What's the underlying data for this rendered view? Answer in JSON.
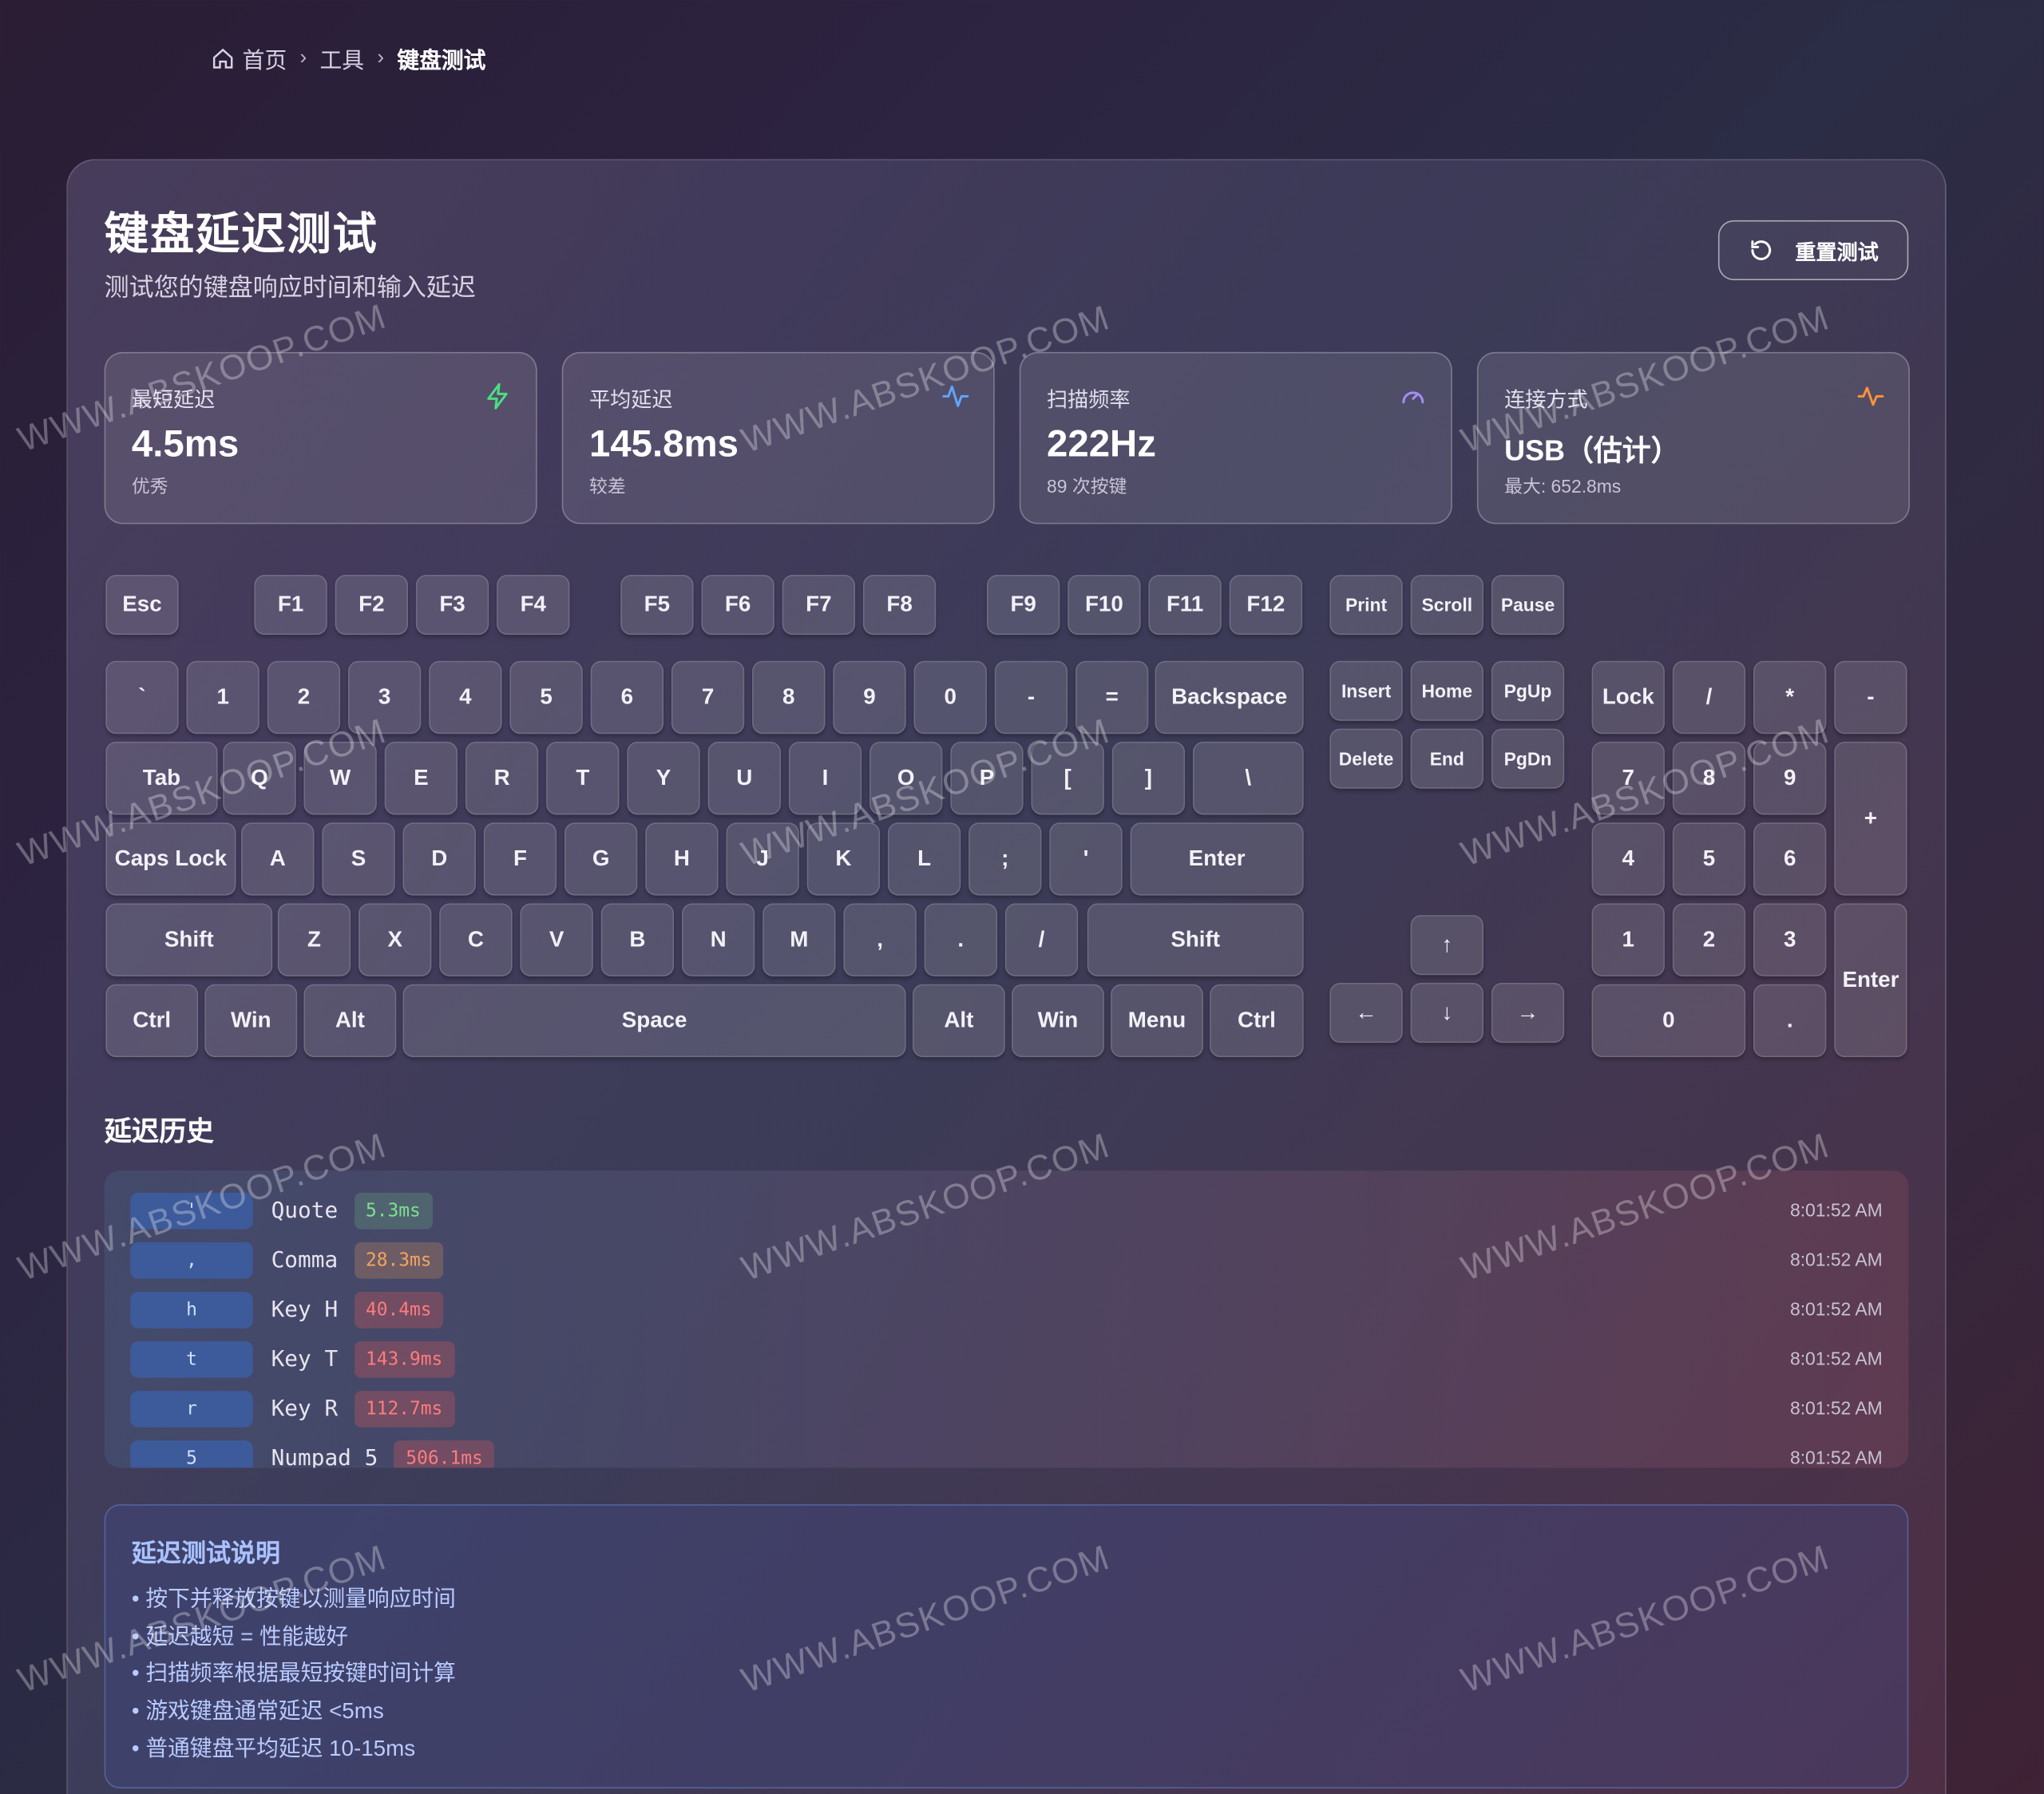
{
  "breadcrumb": {
    "home": "首页",
    "tools": "工具",
    "current": "键盘测试"
  },
  "header": {
    "title": "键盘延迟测试",
    "subtitle": "测试您的键盘响应时间和输入延迟",
    "reset_label": "重置测试"
  },
  "stats": [
    {
      "label": "最短延迟",
      "value": "4.5ms",
      "sub": "优秀",
      "icon": "zap-icon",
      "color": "#4ade80"
    },
    {
      "label": "平均延迟",
      "value": "145.8ms",
      "sub": "较差",
      "icon": "activity-icon",
      "color": "#60a5fa"
    },
    {
      "label": "扫描频率",
      "value": "222Hz",
      "sub": "89 次按键",
      "icon": "gauge-icon",
      "color": "#a78bfa"
    },
    {
      "label": "连接方式",
      "value": "USB（估计）",
      "sub": "最大: 652.8ms",
      "icon": "pulse-icon",
      "color": "#fb923c"
    }
  ],
  "keys": {
    "esc": "Esc",
    "f": [
      "F1",
      "F2",
      "F3",
      "F4",
      "F5",
      "F6",
      "F7",
      "F8",
      "F9",
      "F10",
      "F11",
      "F12"
    ],
    "sys": [
      "Print",
      "Scroll",
      "Pause"
    ],
    "num_row": [
      "`",
      "1",
      "2",
      "3",
      "4",
      "5",
      "6",
      "7",
      "8",
      "9",
      "0",
      "-",
      "="
    ],
    "backspace": "Backspace",
    "tab": "Tab",
    "q_row": [
      "Q",
      "W",
      "E",
      "R",
      "T",
      "Y",
      "U",
      "I",
      "O",
      "P",
      "[",
      "]",
      "\\"
    ],
    "caps": "Caps Lock",
    "a_row": [
      "A",
      "S",
      "D",
      "F",
      "G",
      "H",
      "J",
      "K",
      "L",
      ";",
      "'"
    ],
    "enter": "Enter",
    "shift": "Shift",
    "z_row": [
      "Z",
      "X",
      "C",
      "V",
      "B",
      "N",
      "M",
      ",",
      ".",
      "/"
    ],
    "bottom": {
      "ctrl": "Ctrl",
      "win": "Win",
      "alt": "Alt",
      "space": "Space",
      "menu": "Menu"
    },
    "nav": [
      "Insert",
      "Home",
      "PgUp",
      "Delete",
      "End",
      "PgDn"
    ],
    "arrows": {
      "up": "↑",
      "left": "←",
      "down": "↓",
      "right": "→"
    },
    "numpad": {
      "lock": "Lock",
      "slash": "/",
      "star": "*",
      "minus": "-",
      "plus": "+",
      "enter": "Enter",
      "r1": [
        "7",
        "8",
        "9"
      ],
      "r2": [
        "4",
        "5",
        "6"
      ],
      "r3": [
        "1",
        "2",
        "3"
      ],
      "zero": "0",
      "dot": "."
    }
  },
  "history": {
    "title": "延迟历史",
    "rows": [
      {
        "key": "'",
        "name": "Quote",
        "latency": "5.3ms",
        "level": "good",
        "time": "8:01:52 AM"
      },
      {
        "key": ",",
        "name": "Comma",
        "latency": "28.3ms",
        "level": "mid",
        "time": "8:01:52 AM"
      },
      {
        "key": "h",
        "name": "Key H",
        "latency": "40.4ms",
        "level": "bad",
        "time": "8:01:52 AM"
      },
      {
        "key": "t",
        "name": "Key T",
        "latency": "143.9ms",
        "level": "bad",
        "time": "8:01:52 AM"
      },
      {
        "key": "r",
        "name": "Key R",
        "latency": "112.7ms",
        "level": "bad",
        "time": "8:01:52 AM"
      },
      {
        "key": "5",
        "name": "Numpad 5",
        "latency": "506.1ms",
        "level": "bad",
        "time": "8:01:52 AM"
      }
    ]
  },
  "info": {
    "title": "延迟测试说明",
    "items": [
      "• 按下并释放按键以测量响应时间",
      "• 延迟越短 = 性能越好",
      "• 扫描频率根据最短按键时间计算",
      "• 游戏键盘通常延迟 <5ms",
      "• 普通键盘平均延迟 10-15ms"
    ]
  },
  "watermark": "WWW.ABSKOOP.COM"
}
